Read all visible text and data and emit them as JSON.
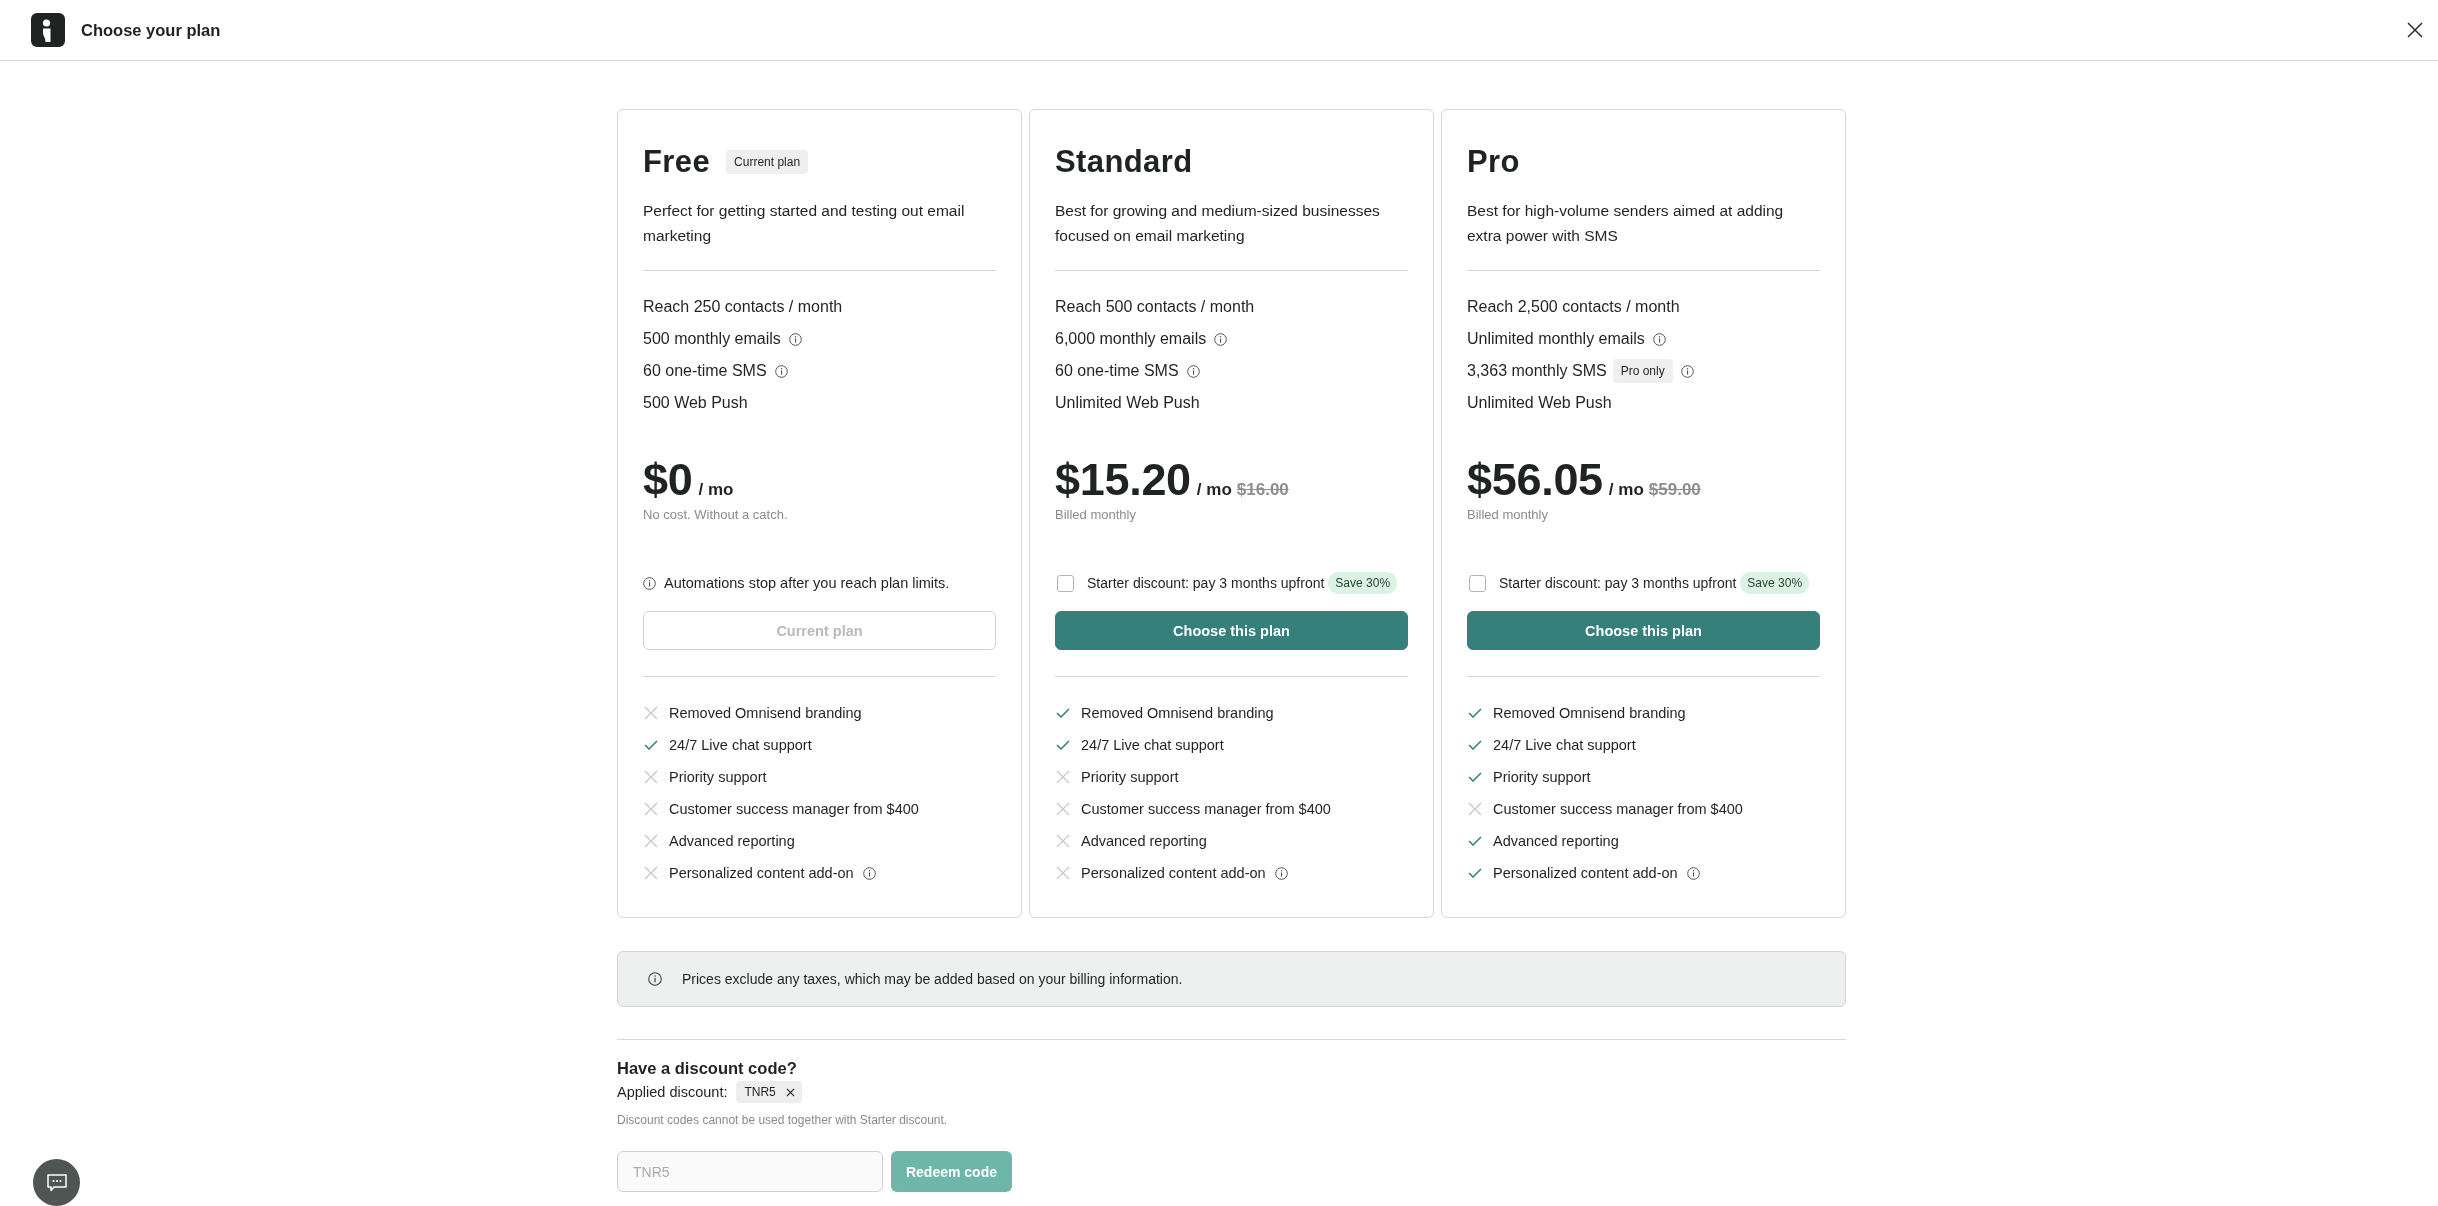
{
  "window": {
    "title": "Choose your plan"
  },
  "plans": [
    {
      "name": "Free",
      "tag": "Current plan",
      "description": "Perfect for getting started and testing out email marketing",
      "limits": [
        {
          "text": "Reach 250 contacts / month",
          "info": false
        },
        {
          "text": "500 monthly emails",
          "info": true
        },
        {
          "text": "60 one-time SMS",
          "info": true
        },
        {
          "text": "500 Web Push",
          "info": false
        }
      ],
      "price": "$0",
      "period": "/ mo",
      "price_note": "No cost. Without a catch.",
      "extra": {
        "kind": "notice",
        "text": "Automations stop after you reach plan limits."
      },
      "button": {
        "label": "Current plan",
        "disabled": true
      },
      "features": [
        {
          "text": "Removed Omnisend branding",
          "included": false,
          "info": false
        },
        {
          "text": "24/7 Live chat support",
          "included": true,
          "info": false
        },
        {
          "text": "Priority support",
          "included": false,
          "info": false
        },
        {
          "text": "Customer success manager from $400",
          "included": false,
          "info": false
        },
        {
          "text": "Advanced reporting",
          "included": false,
          "info": false
        },
        {
          "text": "Personalized content add-on",
          "included": false,
          "info": true
        }
      ]
    },
    {
      "name": "Standard",
      "description": "Best for growing and medium-sized businesses focused on email marketing",
      "limits": [
        {
          "text": "Reach 500 contacts / month",
          "info": false
        },
        {
          "text": "6,000 monthly emails",
          "info": true
        },
        {
          "text": "60 one-time SMS",
          "info": true
        },
        {
          "text": "Unlimited Web Push",
          "info": false
        }
      ],
      "price": "$15.20",
      "period": "/ mo",
      "old_price": "$16.00",
      "price_note": "Billed monthly",
      "extra": {
        "kind": "discount",
        "text": "Starter discount: pay 3 months upfront",
        "tag": "Save 30%",
        "checked": false
      },
      "button": {
        "label": "Choose this plan",
        "disabled": false
      },
      "features": [
        {
          "text": "Removed Omnisend branding",
          "included": true,
          "info": false
        },
        {
          "text": "24/7 Live chat support",
          "included": true,
          "info": false
        },
        {
          "text": "Priority support",
          "included": false,
          "info": false
        },
        {
          "text": "Customer success manager from $400",
          "included": false,
          "info": false
        },
        {
          "text": "Advanced reporting",
          "included": false,
          "info": false
        },
        {
          "text": "Personalized content add-on",
          "included": false,
          "info": true
        }
      ]
    },
    {
      "name": "Pro",
      "description": "Best for high-volume senders aimed at adding extra power with SMS",
      "limits": [
        {
          "text": "Reach 2,500 contacts / month",
          "info": false
        },
        {
          "text": "Unlimited monthly emails",
          "info": true
        },
        {
          "text": "3,363 monthly SMS",
          "tag": "Pro only",
          "info": true
        },
        {
          "text": "Unlimited Web Push",
          "info": false
        }
      ],
      "price": "$56.05",
      "period": "/ mo",
      "old_price": "$59.00",
      "price_note": "Billed monthly",
      "extra": {
        "kind": "discount",
        "text": "Starter discount: pay 3 months upfront",
        "tag": "Save 30%",
        "checked": false
      },
      "button": {
        "label": "Choose this plan",
        "disabled": false
      },
      "features": [
        {
          "text": "Removed Omnisend branding",
          "included": true,
          "info": false
        },
        {
          "text": "24/7 Live chat support",
          "included": true,
          "info": false
        },
        {
          "text": "Priority support",
          "included": true,
          "info": false
        },
        {
          "text": "Customer success manager from $400",
          "included": false,
          "info": false
        },
        {
          "text": "Advanced reporting",
          "included": true,
          "info": false
        },
        {
          "text": "Personalized content add-on",
          "included": true,
          "info": true
        }
      ]
    }
  ],
  "tax_notice": "Prices exclude any taxes, which may be added based on your billing information.",
  "discount": {
    "title": "Have a discount code?",
    "applied_label": "Applied discount:",
    "applied_code": "TNR5",
    "note": "Discount codes cannot be used together with Starter discount.",
    "code_field": {
      "value": "TNR5",
      "disabled": true
    },
    "redeem_button": {
      "label": "Redeem code",
      "disabled": true
    }
  }
}
